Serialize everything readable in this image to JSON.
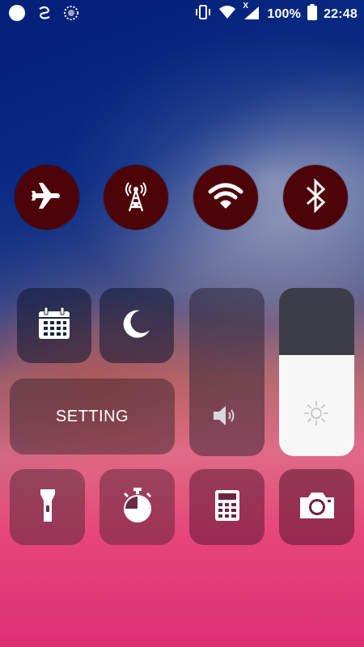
{
  "status_bar": {
    "battery_percent": "100%",
    "time": "22:48",
    "network_badge": "X"
  },
  "toggles": [
    {
      "name": "airplane",
      "active": true
    },
    {
      "name": "cellular",
      "active": true
    },
    {
      "name": "wifi",
      "active": true
    },
    {
      "name": "bluetooth",
      "active": true
    }
  ],
  "tiles": {
    "setting_label": "SETTING"
  },
  "brightness_level": 0.6,
  "colors": {
    "toggle_bg": "#4d0409",
    "tile_bg": "rgba(25,25,40,0.35)",
    "brightness_fill": "#f7f7f7",
    "icon": "#ffffff"
  },
  "icons": [
    "circle-icon",
    "route-icon",
    "sync-icon",
    "vibrate-icon",
    "wifi-icon",
    "signal-icon",
    "battery-icon",
    "airplane-icon",
    "antenna-icon",
    "wifi-icon",
    "bluetooth-icon",
    "calendar-icon",
    "moon-icon",
    "speaker-icon",
    "sun-icon",
    "flashlight-icon",
    "timer-icon",
    "calculator-icon",
    "camera-icon"
  ]
}
